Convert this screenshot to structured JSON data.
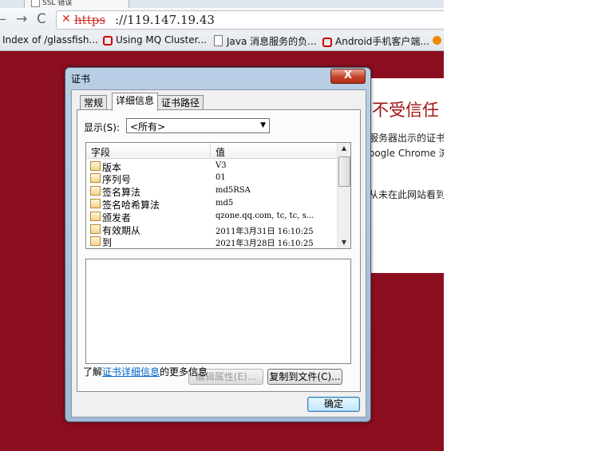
{
  "browser": {
    "tab_title": "SSL 错误",
    "url_scheme": "https",
    "url_host": "://119.147.19.43",
    "bookmarks": [
      {
        "label": "Index of /glassfish...",
        "icon": "page-icon"
      },
      {
        "label": "Using MQ Cluster...",
        "icon": "red-c-icon"
      },
      {
        "label": "Java 消息服务的负...",
        "icon": "document-icon"
      },
      {
        "label": "Android手机客户端...",
        "icon": "red-c-icon"
      },
      {
        "label": "",
        "icon": "orange-rss-icon"
      }
    ]
  },
  "warning_page": {
    "title": "不受信任",
    "line1": "服务器出示的证书",
    "line2": "oogle Chrome 浏",
    "line3": "从未在此网站看到过"
  },
  "dialog": {
    "title": "证书",
    "close_label": "X",
    "tabs": [
      {
        "label": "常规",
        "active": false
      },
      {
        "label": "详细信息",
        "active": true
      },
      {
        "label": "证书路径",
        "active": false
      }
    ],
    "show_label": "显示(S):",
    "show_value": "<所有>",
    "columns": {
      "field": "字段",
      "value": "值"
    },
    "rows": [
      {
        "field": "版本",
        "value": "V3"
      },
      {
        "field": "序列号",
        "value": "01"
      },
      {
        "field": "签名算法",
        "value": "md5RSA"
      },
      {
        "field": "签名哈希算法",
        "value": "md5"
      },
      {
        "field": "颁发者",
        "value": "qzone.qq.com, tc, tc, s..."
      },
      {
        "field": "有效期从",
        "value": "2011年3月31日 16:10:25"
      },
      {
        "field": "到",
        "value": "2021年3月28日 16:10:25"
      }
    ],
    "edit_properties_label": "编辑属性(E)...",
    "copy_to_file_label": "复制到文件(C)...",
    "learn_prefix": "了解",
    "learn_link": "证书详细信息",
    "learn_suffix": "的更多信息",
    "ok_label": "确定"
  }
}
